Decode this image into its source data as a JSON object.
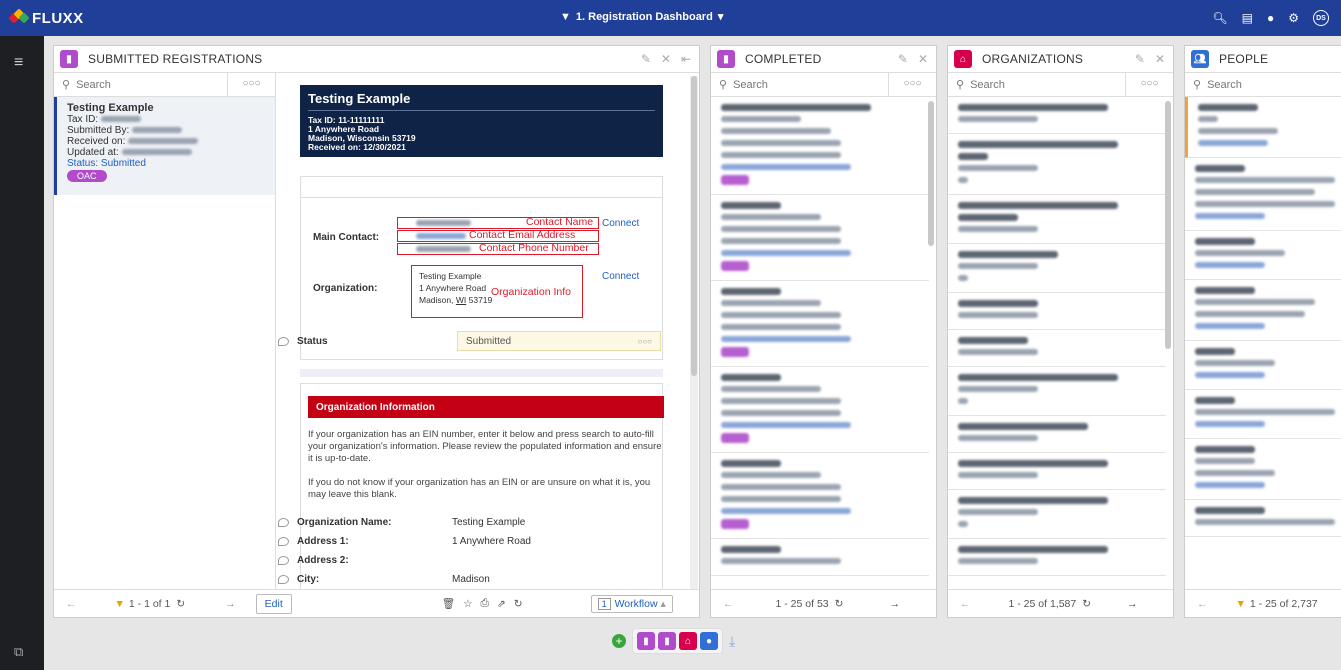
{
  "app": {
    "name": "FLUXX",
    "dashboard": "1. Registration Dashboard",
    "avatar": "DS"
  },
  "colors": {
    "topbar": "#1f3f99",
    "purple": "#b04bc9",
    "org_red": "#d6004c",
    "people_blue": "#2f6fd6",
    "annotation_red": "#e0192a"
  },
  "icons": {
    "filter": "funnel-icon",
    "search": "magnifier-icon"
  },
  "submitted": {
    "title": "SUBMITTED REGISTRATIONS",
    "search_placeholder": "Search",
    "item": {
      "name": "Testing Example",
      "tax_label": "Tax ID:",
      "submitted_by_label": "Submitted By:",
      "received_label": "Received on:",
      "updated_label": "Updated at:",
      "status": "Status: Submitted",
      "tag": "OAC"
    },
    "pagination": "1 - 1 of 1"
  },
  "detail": {
    "name": "Testing Example",
    "tax_id": "Tax ID: 11-11111111",
    "address1": "1 Anywhere Road",
    "address2": "Madison, Wisconsin 53719",
    "received": "Received on: 12/30/2021",
    "main_contact_label": "Main Contact:",
    "organization_label": "Organization:",
    "connect": "Connect",
    "annot_name": "Contact Name",
    "annot_email": "Contact Email Address",
    "annot_phone": "Contact Phone Number",
    "annot_org": "Organization Info",
    "org_name": "Testing Example",
    "org_address1": "1 Anywhere Road",
    "org_city_prefix": "Madison, ",
    "org_state": "WI",
    "org_zip": " 53719",
    "status_label": "Status",
    "status_value": "Submitted",
    "org_info_header": "Organization Information",
    "para1": "If your organization has an EIN number, enter it below and press search to auto-fill your organization's information. Please review the populated information and ensure it is up-to-date.",
    "para2": "If you do not know if your organization has an EIN or are unsure on what it is, you may leave this blank.",
    "fields": [
      {
        "label": "Organization Name:",
        "value": "Testing Example"
      },
      {
        "label": "Address 1:",
        "value": "1 Anywhere Road"
      },
      {
        "label": "Address 2:",
        "value": ""
      },
      {
        "label": "City:",
        "value": "Madison"
      }
    ],
    "edit": "Edit",
    "workflow_count": "1",
    "workflow": "Workflow"
  },
  "completed": {
    "title": "COMPLETED",
    "search_placeholder": "Search",
    "pagination": "1 - 25 of 53"
  },
  "organizations": {
    "title": "ORGANIZATIONS",
    "search_placeholder": "Search",
    "pagination": "1 - 25 of 1,587"
  },
  "people": {
    "title": "PEOPLE",
    "search_placeholder": "Search",
    "pagination": "1 - 25 of 2,737"
  }
}
